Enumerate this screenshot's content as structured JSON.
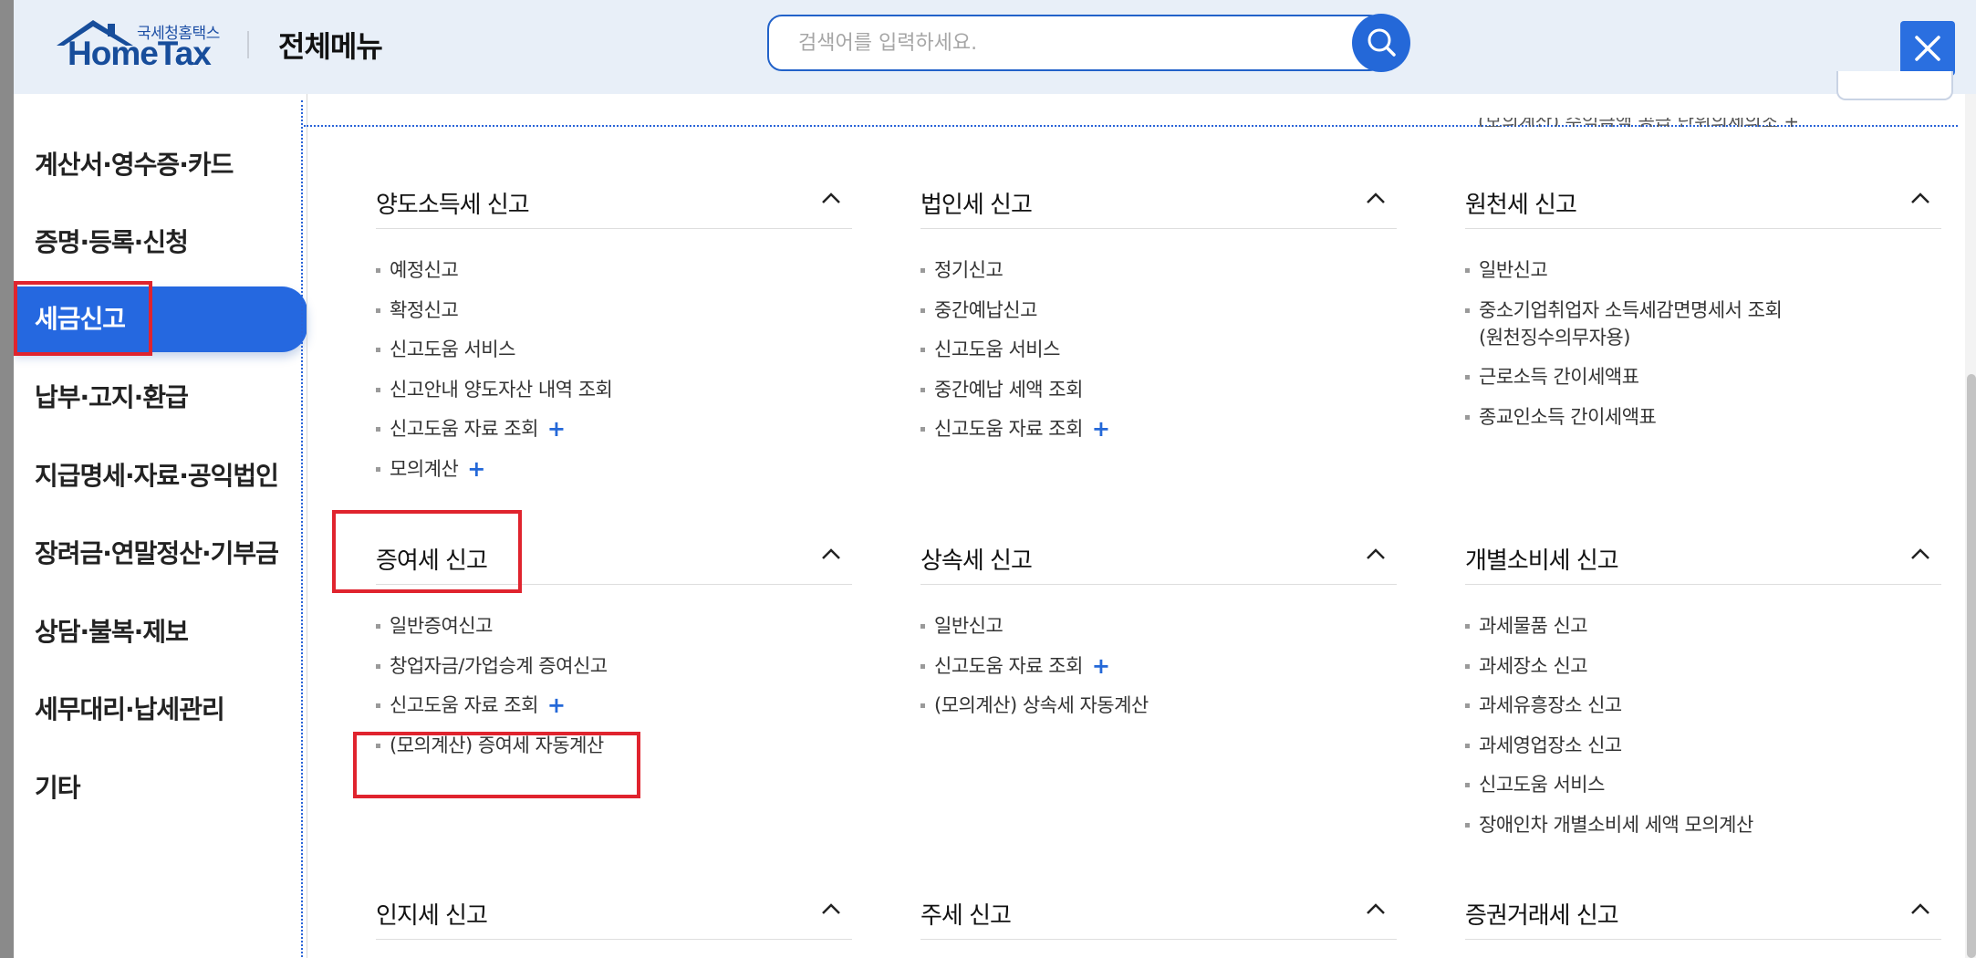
{
  "header": {
    "logo_sub": "국세청홈택스",
    "logo_main": "HomeTax",
    "title": "전체메뉴",
    "search_placeholder": "검색어를 입력하세요."
  },
  "sidebar": {
    "items": [
      {
        "label": "계산서·영수증·카드"
      },
      {
        "label": "증명·등록·신청"
      },
      {
        "label": "세금신고",
        "active": true
      },
      {
        "label": "납부·고지·환급"
      },
      {
        "label": "지급명세·자료·공익법인"
      },
      {
        "label": "장려금·연말정산·기부금"
      },
      {
        "label": "상담·불복·제보"
      },
      {
        "label": "세무대리·납세관리"
      },
      {
        "label": "기타"
      }
    ]
  },
  "content": {
    "cut_text": "(모의계산) 수익금액 공급 단위의세의조 +",
    "sections": [
      {
        "title": "양도소득세 신고",
        "items": [
          {
            "label": "예정신고"
          },
          {
            "label": "확정신고"
          },
          {
            "label": "신고도움 서비스"
          },
          {
            "label": "신고안내 양도자산 내역 조회"
          },
          {
            "label": "신고도움 자료 조회",
            "plus": "+"
          },
          {
            "label": "모의계산",
            "plus": "+"
          }
        ]
      },
      {
        "title": "법인세 신고",
        "items": [
          {
            "label": "정기신고"
          },
          {
            "label": "중간예납신고"
          },
          {
            "label": "신고도움 서비스"
          },
          {
            "label": "중간예납 세액 조회"
          },
          {
            "label": "신고도움 자료 조회",
            "plus": "+"
          }
        ]
      },
      {
        "title": "원천세 신고",
        "items": [
          {
            "label": "일반신고"
          },
          {
            "label": "중소기업취업자 소득세감면명세서 조회",
            "line2": "(원천징수의무자용)"
          },
          {
            "label": "근로소득 간이세액표"
          },
          {
            "label": "종교인소득 간이세액표"
          }
        ]
      },
      {
        "title": "증여세 신고",
        "items": [
          {
            "label": "일반증여신고"
          },
          {
            "label": "창업자금/가업승계 증여신고"
          },
          {
            "label": "신고도움 자료 조회",
            "plus": "+"
          },
          {
            "label": "(모의계산) 증여세 자동계산"
          }
        ]
      },
      {
        "title": "상속세 신고",
        "items": [
          {
            "label": "일반신고"
          },
          {
            "label": "신고도움 자료 조회",
            "plus": "+"
          },
          {
            "label": "(모의계산) 상속세 자동계산"
          }
        ]
      },
      {
        "title": "개별소비세 신고",
        "items": [
          {
            "label": "과세물품 신고"
          },
          {
            "label": "과세장소 신고"
          },
          {
            "label": "과세유흥장소 신고"
          },
          {
            "label": "과세영업장소 신고"
          },
          {
            "label": "신고도움 서비스"
          },
          {
            "label": "장애인차 개별소비세 세액 모의계산"
          }
        ]
      },
      {
        "title": "인지세 신고",
        "items": []
      },
      {
        "title": "주세 신고",
        "items": []
      },
      {
        "title": "증권거래세 신고",
        "items": []
      }
    ]
  },
  "colors": {
    "accent": "#2568e0",
    "header_bg": "#e8eff8",
    "highlight_red": "#e0242e"
  }
}
